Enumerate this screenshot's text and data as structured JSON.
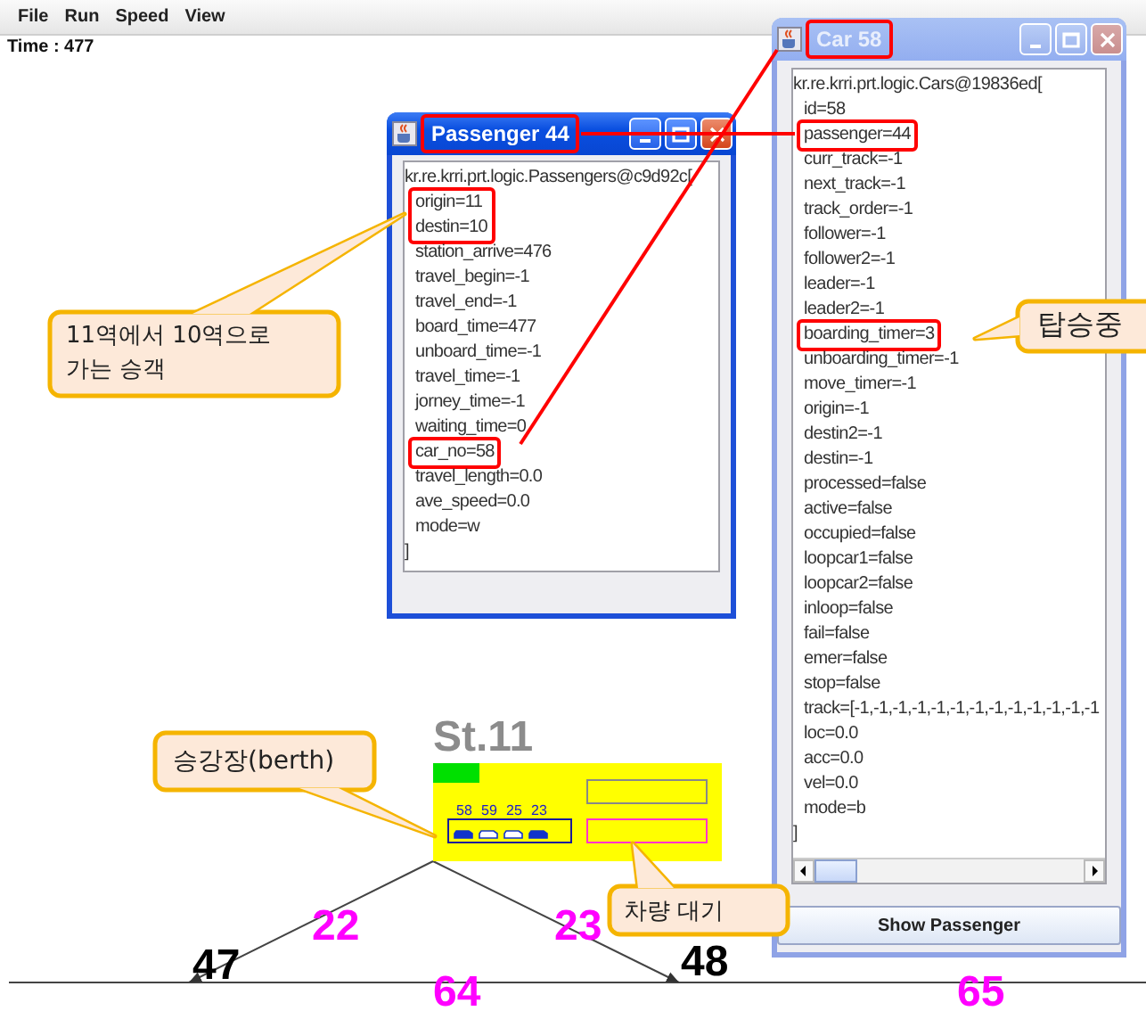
{
  "menu": [
    "File",
    "Run",
    "Speed",
    "View"
  ],
  "time_label": "Time : 477",
  "station": {
    "name": "St.11",
    "berth_cars": [
      {
        "number": "58",
        "filled": true
      },
      {
        "number": "59",
        "filled": false
      },
      {
        "number": "25",
        "filled": false
      },
      {
        "number": "23",
        "filled": true
      }
    ]
  },
  "track_labels": [
    {
      "text": "22",
      "kind": "link"
    },
    {
      "text": "23",
      "kind": "link"
    },
    {
      "text": "47",
      "kind": "node"
    },
    {
      "text": "48",
      "kind": "node"
    },
    {
      "text": "64",
      "kind": "link"
    },
    {
      "text": "65",
      "kind": "link"
    }
  ],
  "passenger_window": {
    "title": "Passenger 44",
    "active": true,
    "title_highlighted": true,
    "lines": [
      {
        "text": "kr.re.krri.prt.logic.Passengers@c9d92c[",
        "highlighted": false
      },
      {
        "text": "origin=11",
        "highlighted": true
      },
      {
        "text": "destin=10",
        "highlighted": true
      },
      {
        "text": "station_arrive=476",
        "highlighted": false
      },
      {
        "text": "travel_begin=-1",
        "highlighted": false
      },
      {
        "text": "travel_end=-1",
        "highlighted": false
      },
      {
        "text": "board_time=477",
        "highlighted": false
      },
      {
        "text": "unboard_time=-1",
        "highlighted": false
      },
      {
        "text": "travel_time=-1",
        "highlighted": false
      },
      {
        "text": "jorney_time=-1",
        "highlighted": false
      },
      {
        "text": "waiting_time=0",
        "highlighted": false
      },
      {
        "text": "car_no=58",
        "highlighted": true
      },
      {
        "text": "travel_length=0.0",
        "highlighted": false
      },
      {
        "text": "ave_speed=0.0",
        "highlighted": false
      },
      {
        "text": "mode=w",
        "highlighted": false
      },
      {
        "text": "]",
        "highlighted": false
      }
    ]
  },
  "car_window": {
    "title": "Car 58",
    "active": false,
    "title_highlighted": true,
    "button": "Show Passenger",
    "lines": [
      {
        "text": "kr.re.krri.prt.logic.Cars@19836ed[",
        "highlighted": false
      },
      {
        "text": "id=58",
        "highlighted": false
      },
      {
        "text": "passenger=44",
        "highlighted": true
      },
      {
        "text": "curr_track=-1",
        "highlighted": false
      },
      {
        "text": "next_track=-1",
        "highlighted": false
      },
      {
        "text": "track_order=-1",
        "highlighted": false
      },
      {
        "text": "follower=-1",
        "highlighted": false
      },
      {
        "text": "follower2=-1",
        "highlighted": false
      },
      {
        "text": "leader=-1",
        "highlighted": false
      },
      {
        "text": "leader2=-1",
        "highlighted": false
      },
      {
        "text": "boarding_timer=3",
        "highlighted": true
      },
      {
        "text": "unboarding_timer=-1",
        "highlighted": false
      },
      {
        "text": "move_timer=-1",
        "highlighted": false
      },
      {
        "text": "origin=-1",
        "highlighted": false
      },
      {
        "text": "destin2=-1",
        "highlighted": false
      },
      {
        "text": "destin=-1",
        "highlighted": false
      },
      {
        "text": "processed=false",
        "highlighted": false
      },
      {
        "text": "active=false",
        "highlighted": false
      },
      {
        "text": "occupied=false",
        "highlighted": false
      },
      {
        "text": "loopcar1=false",
        "highlighted": false
      },
      {
        "text": "loopcar2=false",
        "highlighted": false
      },
      {
        "text": "inloop=false",
        "highlighted": false
      },
      {
        "text": "fail=false",
        "highlighted": false
      },
      {
        "text": "emer=false",
        "highlighted": false
      },
      {
        "text": "stop=false",
        "highlighted": false
      },
      {
        "text": "track=[-1,-1,-1,-1,-1,-1,-1,-1,-1,-1,-1,-1,-1",
        "highlighted": false
      },
      {
        "text": "loc=0.0",
        "highlighted": false
      },
      {
        "text": "acc=0.0",
        "highlighted": false
      },
      {
        "text": "vel=0.0",
        "highlighted": false
      },
      {
        "text": "mode=b",
        "highlighted": false
      },
      {
        "text": "]",
        "highlighted": false
      }
    ]
  },
  "annotations": [
    {
      "text": "11역에서 10역으로\n가는 승객"
    },
    {
      "text": "탑승중"
    },
    {
      "text": "승강장(berth)"
    },
    {
      "text": "차량 대기"
    }
  ]
}
